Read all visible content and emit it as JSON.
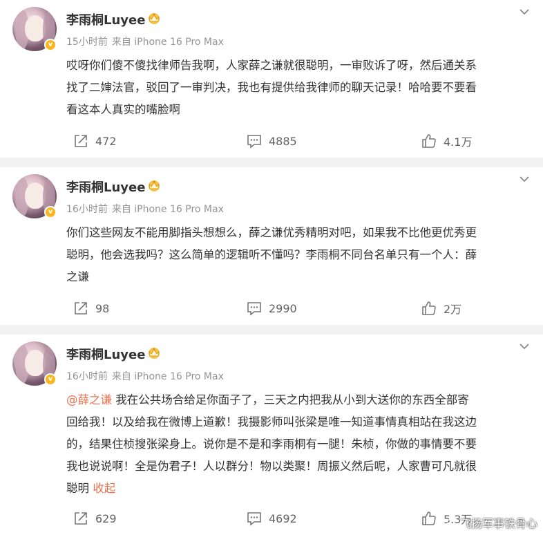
{
  "posts": [
    {
      "author": "李雨桐Luyee",
      "time": "15小时前",
      "source": "来自 iPhone 16 Pro Max",
      "lines": [
        "哎呀你们傻不傻找律师告我啊，人家薛之谦就很聪明，一审败诉了呀，然后通关系",
        "找了二婶法官，驳回了一审判决，我也有提供给我律师的聊天记录！哈哈要不要看",
        "看这本人真实的嘴脸啊"
      ],
      "shares": "472",
      "comments": "4885",
      "likes": "4.1万"
    },
    {
      "author": "李雨桐Luyee",
      "time": "16小时前",
      "source": "来自 iPhone 16 Pro Max",
      "lines": [
        "你们这些网友不能用脚指头想想么，薛之谦优秀精明对吧，如果我不比他更优秀更",
        "聪明，他会选我吗？这么简单的逻辑听不懂吗？李雨桐不同台名单只有一个人：薛",
        "之谦"
      ],
      "shares": "98",
      "comments": "2990",
      "likes": "2万"
    },
    {
      "author": "李雨桐Luyee",
      "time": "16小时前",
      "source": "来自 iPhone 16 Pro Max",
      "mention": "@薛之谦",
      "first_line_rest": " 我在公共场合给足你面子了，三天之内把我从小到大送你的东西全部寄",
      "lines": [
        "回给我！以及给我在微博上道歉！我摄影师叫张梁是唯一知道事情真相站在我这边",
        "的，结果住桢搜张梁身上。说你是不是和李雨桐有一腿！朱桢，你做的事情要不要",
        "我也说说啊！全是伪君子！人以群分！物以类聚！周振义然后呢，人家曹可凡就很"
      ],
      "last_line": "聪明 ",
      "fold": "收起",
      "shares": "629",
      "comments": "4692",
      "likes": "5.3万"
    }
  ],
  "watermark": "飞扬军事铁骨心",
  "colors": {
    "accent": "#eb7350",
    "verified": "#f8b51d",
    "meta": "#939393",
    "divider": "#f2f2f2"
  },
  "icons": {
    "share": "share-icon",
    "comment": "comment-icon",
    "like": "like-icon",
    "more": "chevron-down-icon",
    "crown": "crown-badge-icon"
  }
}
